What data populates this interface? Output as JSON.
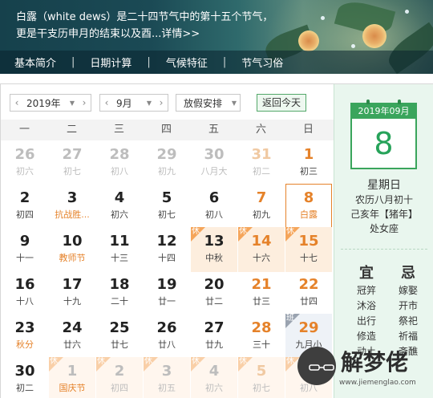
{
  "banner": {
    "intro_line1": "白露（white dews）是二十四节气中的第十五个节气，",
    "intro_line2": "更是干支历申月的结束以及酉...",
    "more_link": "详情>>",
    "nav": [
      "基本简介",
      "日期计算",
      "气候特征",
      "节气习俗"
    ]
  },
  "toolbar": {
    "year": "2019年",
    "month": "9月",
    "holiday_select": "放假安排",
    "today_button": "返回今天",
    "prev_symbol": "‹",
    "next_symbol": "›"
  },
  "weekdays": [
    "一",
    "二",
    "三",
    "四",
    "五",
    "六",
    "日"
  ],
  "calendar": {
    "rows": [
      [
        {
          "d": "26",
          "l": "初六",
          "other": true
        },
        {
          "d": "27",
          "l": "初七",
          "other": true
        },
        {
          "d": "28",
          "l": "初八",
          "other": true
        },
        {
          "d": "29",
          "l": "初九",
          "other": true
        },
        {
          "d": "30",
          "l": "八月大",
          "other": true
        },
        {
          "d": "31",
          "l": "初二",
          "other": true,
          "weekend": true
        },
        {
          "d": "1",
          "l": "初三",
          "weekend": true
        }
      ],
      [
        {
          "d": "2",
          "l": "初四"
        },
        {
          "d": "3",
          "l": "抗战胜...",
          "festival": true
        },
        {
          "d": "4",
          "l": "初六"
        },
        {
          "d": "5",
          "l": "初七"
        },
        {
          "d": "6",
          "l": "初八"
        },
        {
          "d": "7",
          "l": "初九",
          "weekend": true
        },
        {
          "d": "8",
          "l": "白露",
          "weekend": true,
          "selected": true
        }
      ],
      [
        {
          "d": "9",
          "l": "十一"
        },
        {
          "d": "10",
          "l": "教师节",
          "festival": true
        },
        {
          "d": "11",
          "l": "十三"
        },
        {
          "d": "12",
          "l": "十四"
        },
        {
          "d": "13",
          "l": "中秋",
          "holiday": true,
          "tag": "休"
        },
        {
          "d": "14",
          "l": "十六",
          "holiday": true,
          "weekend": true,
          "tag": "休"
        },
        {
          "d": "15",
          "l": "十七",
          "holiday": true,
          "weekend": true,
          "tag": "休"
        }
      ],
      [
        {
          "d": "16",
          "l": "十八"
        },
        {
          "d": "17",
          "l": "十九"
        },
        {
          "d": "18",
          "l": "二十"
        },
        {
          "d": "19",
          "l": "廿一"
        },
        {
          "d": "20",
          "l": "廿二"
        },
        {
          "d": "21",
          "l": "廿三",
          "weekend": true
        },
        {
          "d": "22",
          "l": "廿四",
          "weekend": true
        }
      ],
      [
        {
          "d": "23",
          "l": "秋分",
          "festival": true
        },
        {
          "d": "24",
          "l": "廿六"
        },
        {
          "d": "25",
          "l": "廿七"
        },
        {
          "d": "26",
          "l": "廿八"
        },
        {
          "d": "27",
          "l": "廿九"
        },
        {
          "d": "28",
          "l": "三十",
          "weekend": true
        },
        {
          "d": "29",
          "l": "九月小",
          "weekend": true,
          "workday": true,
          "tag": "班"
        }
      ],
      [
        {
          "d": "30",
          "l": "初二"
        },
        {
          "d": "1",
          "l": "国庆节",
          "other": true,
          "holiday": true,
          "festival": true,
          "tag": "休"
        },
        {
          "d": "2",
          "l": "初四",
          "other": true,
          "holiday": true,
          "tag": "休"
        },
        {
          "d": "3",
          "l": "初五",
          "other": true,
          "holiday": true,
          "tag": "休"
        },
        {
          "d": "4",
          "l": "初六",
          "other": true,
          "holiday": true,
          "tag": "休"
        },
        {
          "d": "5",
          "l": "初七",
          "other": true,
          "holiday": true,
          "weekend": true,
          "tag": "休"
        },
        {
          "d": "6",
          "l": "初八",
          "other": true,
          "holiday": true,
          "weekend": true,
          "tag": "休"
        }
      ]
    ]
  },
  "detail": {
    "card_header": "2019年09月",
    "day": "8",
    "weekday": "星期日",
    "lunar": "农历八月初十",
    "ganzhi": "己亥年【猪年】",
    "zodiac_sign": "处女座",
    "yi_title": "宜",
    "ji_title": "忌",
    "yi": [
      "冠笄",
      "沐浴",
      "出行",
      "修造",
      "动土"
    ],
    "ji": [
      "嫁娶",
      "开市",
      "祭祀",
      "祈福",
      "斋醮"
    ]
  },
  "watermark": {
    "brand": "解梦佬",
    "url": "www.jiemenglao.com"
  },
  "colors": {
    "accent_green": "#3aa55c",
    "accent_orange": "#e5822a",
    "holiday_bg": "#fdeede"
  }
}
